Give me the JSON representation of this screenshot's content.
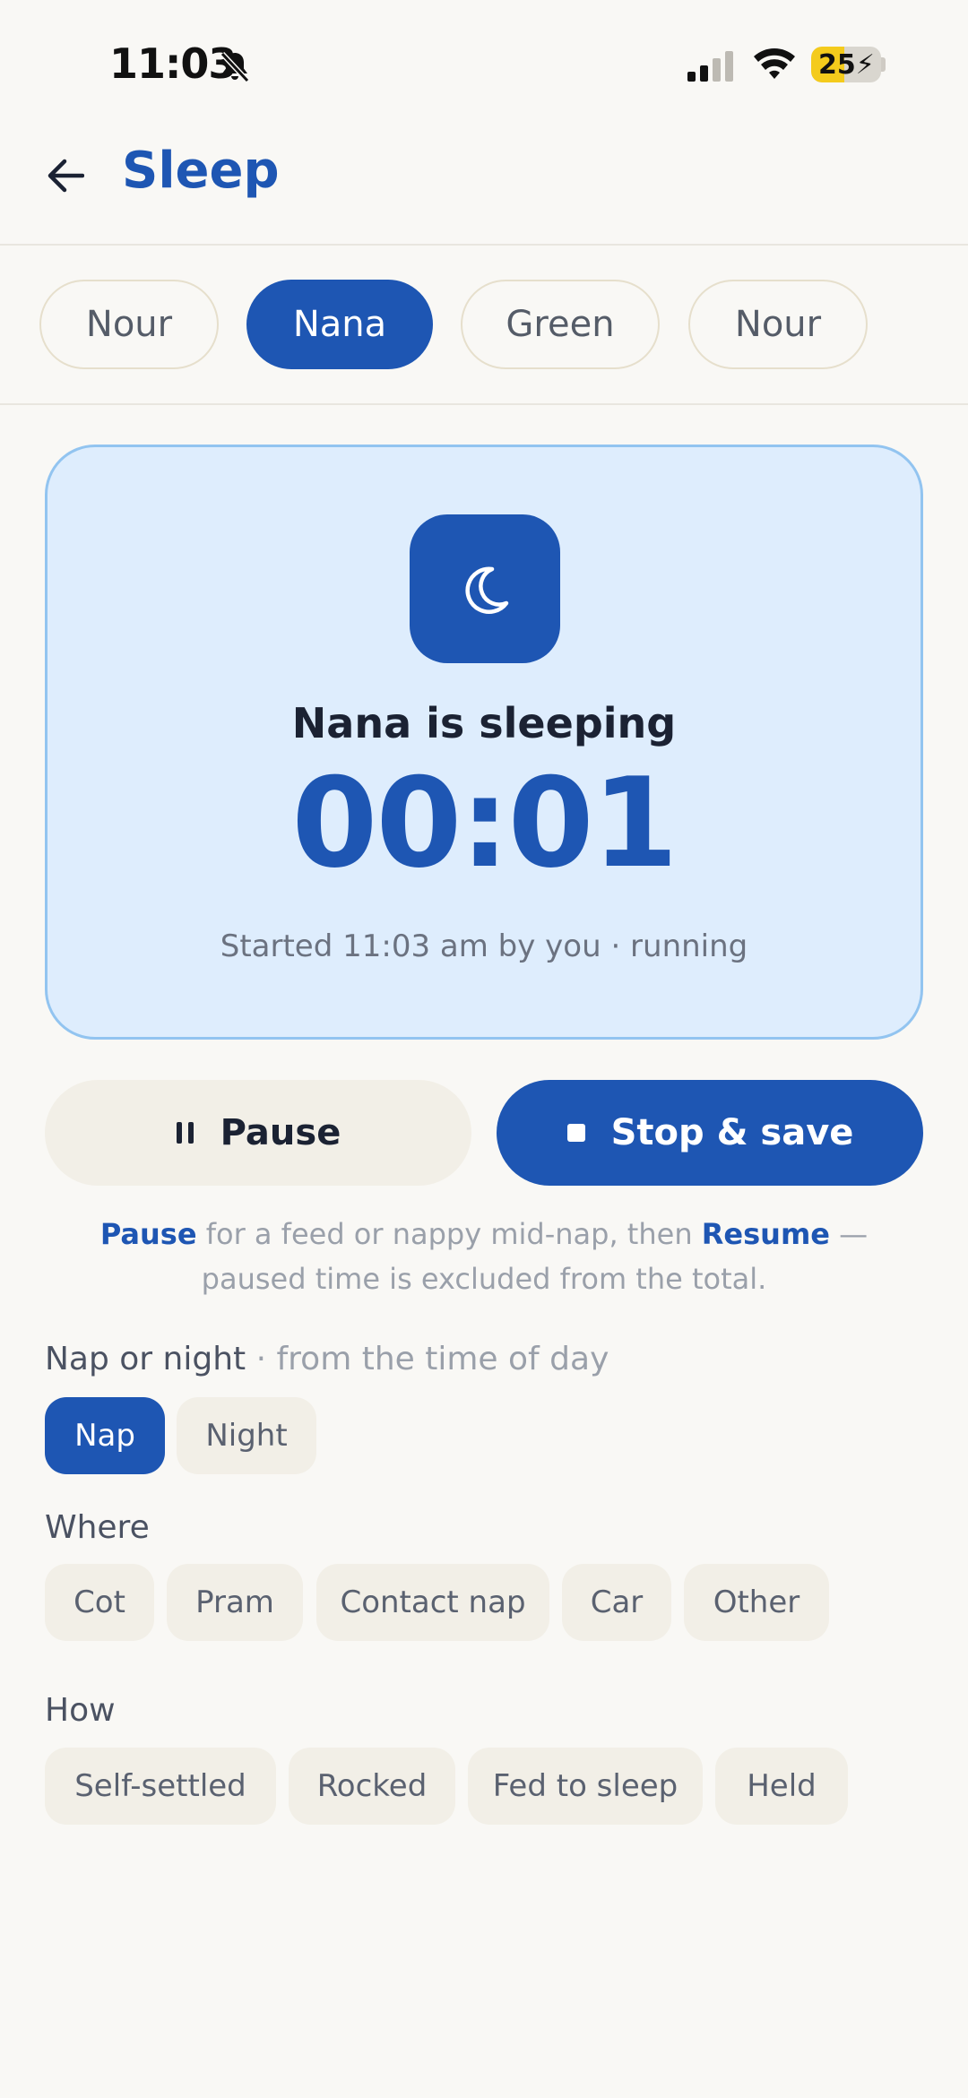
{
  "status_bar": {
    "time": "11:03",
    "battery": "25",
    "battery_level": 0.25
  },
  "header": {
    "title": "Sleep"
  },
  "children": [
    {
      "label": "Nour",
      "active": false
    },
    {
      "label": "Nana",
      "active": true
    },
    {
      "label": "Green",
      "active": false
    },
    {
      "label": "Nour",
      "active": false
    }
  ],
  "session": {
    "status": "Nana is sleeping",
    "timer": "00:01",
    "started": "Started 11:03 am by you · running"
  },
  "actions": {
    "pause_label": "Pause",
    "stop_label": "Stop & save"
  },
  "hint": {
    "pause_word": "Pause",
    "middle": " for a feed or nappy mid-nap, then ",
    "resume_word": "Resume",
    "end": " — paused time is excluded from the total."
  },
  "nap_or_night": {
    "label": "Nap or night",
    "sub": " · from the time of day",
    "options": [
      {
        "label": "Nap",
        "active": true
      },
      {
        "label": "Night",
        "active": false
      }
    ]
  },
  "where": {
    "label": "Where",
    "options": [
      "Cot",
      "Pram",
      "Contact nap",
      "Car",
      "Other"
    ]
  },
  "how": {
    "label": "How",
    "options": [
      "Self-settled",
      "Rocked",
      "Fed to sleep",
      "Held"
    ]
  },
  "colors": {
    "accent": "#1e56b3",
    "card_bg": "#deedfd",
    "card_border": "#92c4f0",
    "background": "#f9f8f5"
  }
}
